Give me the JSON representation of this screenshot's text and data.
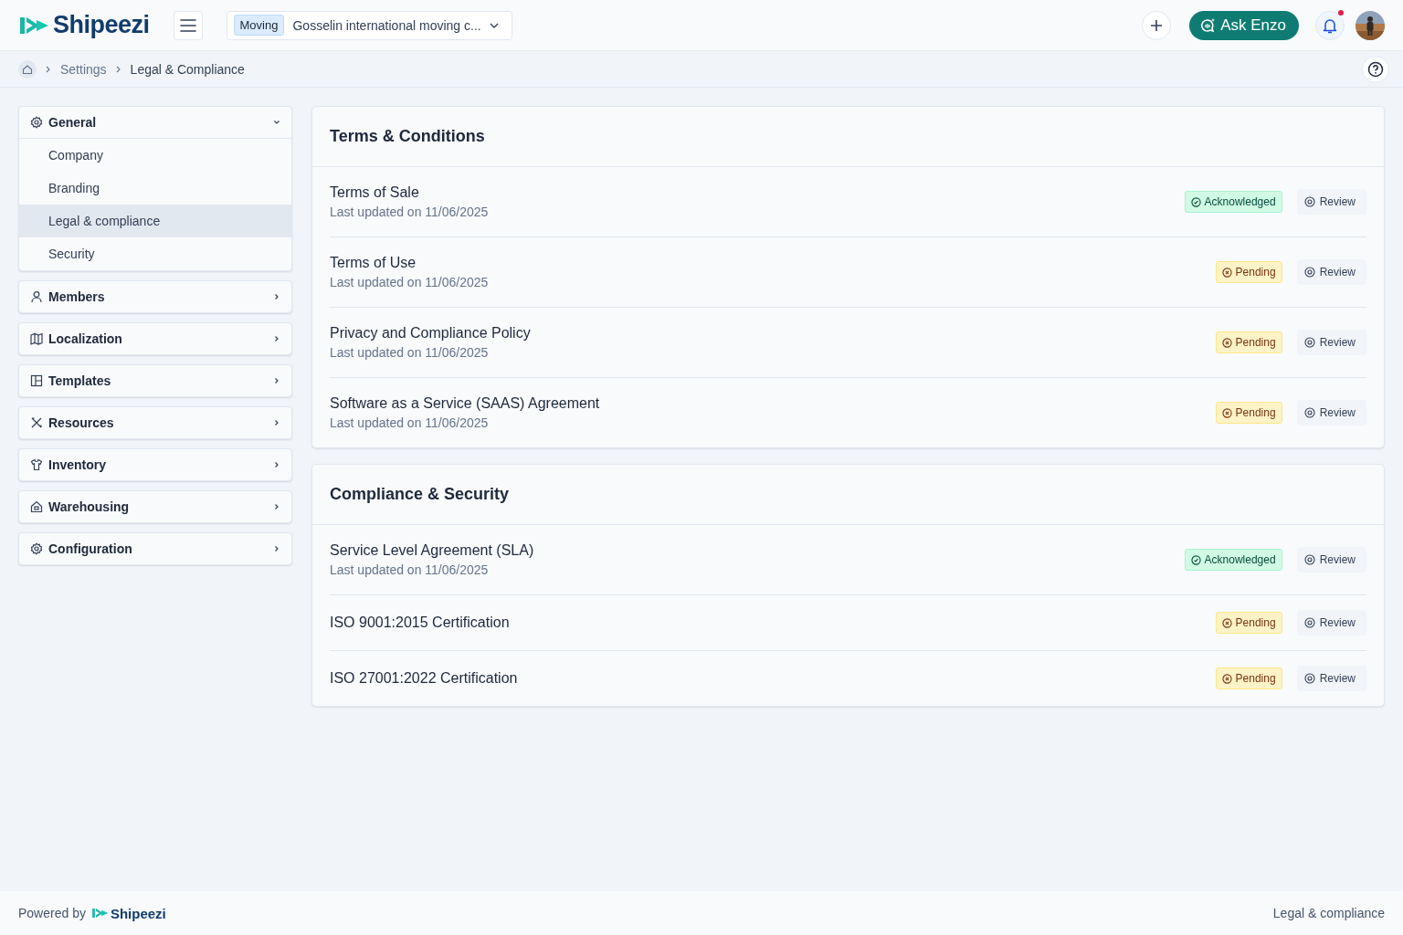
{
  "header": {
    "logo": "Shipeezi",
    "tag": "Moving",
    "company": "Gosselin international moving c...",
    "ask_button": "Ask Enzo",
    "has_notification": true
  },
  "breadcrumb": [
    "Settings",
    "Legal & Compliance"
  ],
  "sidebar": [
    {
      "label": "General",
      "expanded": true,
      "items": [
        {
          "label": "Company",
          "selected": false
        },
        {
          "label": "Branding",
          "selected": false
        },
        {
          "label": "Legal & compliance",
          "selected": true
        },
        {
          "label": "Security",
          "selected": false
        }
      ]
    },
    {
      "label": "Members",
      "expanded": false
    },
    {
      "label": "Localization",
      "expanded": false
    },
    {
      "label": "Templates",
      "expanded": false
    },
    {
      "label": "Resources",
      "expanded": false
    },
    {
      "label": "Inventory",
      "expanded": false
    },
    {
      "label": "Warehousing",
      "expanded": false
    },
    {
      "label": "Configuration",
      "expanded": false
    }
  ],
  "sections": [
    {
      "title": "Terms & Conditions",
      "documents": [
        {
          "name": "Terms of Sale",
          "updated": "Last updated on 11/06/2025",
          "kind": "acknowledged",
          "status": "Acknowledged",
          "action": "Review"
        },
        {
          "name": "Terms of Use",
          "updated": "Last updated on 11/06/2025",
          "kind": "pending",
          "status": "Pending",
          "action": "Review"
        },
        {
          "name": "Privacy and Compliance Policy",
          "updated": "Last updated on 11/06/2025",
          "kind": "pending",
          "status": "Pending",
          "action": "Review"
        },
        {
          "name": "Software as a Service (SAAS) Agreement",
          "updated": "Last updated on 11/06/2025",
          "kind": "pending",
          "status": "Pending",
          "action": "Review"
        }
      ]
    },
    {
      "title": "Compliance & Security",
      "documents": [
        {
          "name": "Service Level Agreement (SLA)",
          "updated": "Last updated on 11/06/2025",
          "kind": "acknowledged",
          "status": "Acknowledged",
          "action": "Review"
        },
        {
          "name": "ISO 9001:2015 Certification",
          "kind": "pending",
          "status": "Pending",
          "action": "Review"
        },
        {
          "name": "ISO 27001:2022 Certification",
          "kind": "pending",
          "status": "Pending",
          "action": "Review"
        }
      ]
    }
  ],
  "footer": {
    "powered": "Powered by",
    "logo": "Shipeezi",
    "page": "Legal & compliance"
  }
}
